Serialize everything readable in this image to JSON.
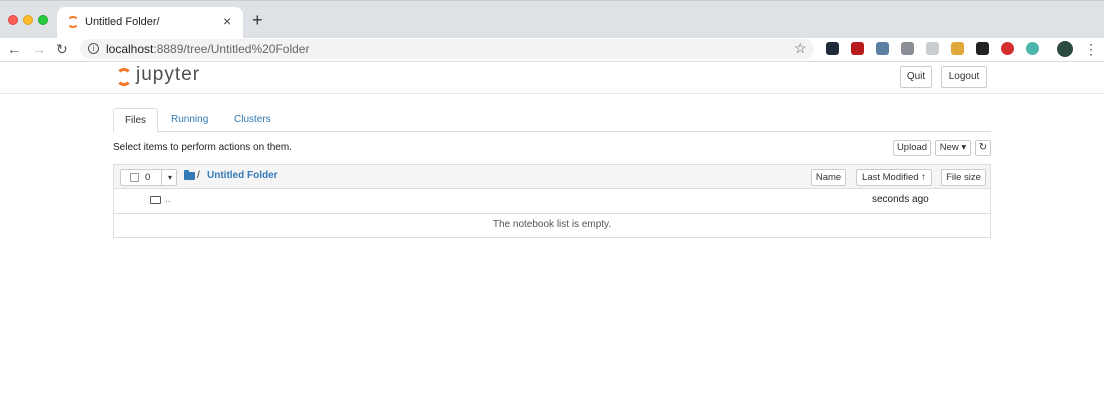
{
  "browser": {
    "tab_title": "Untitled Folder/",
    "url_host": "localhost",
    "url_rest": ":8889/tree/Untitled%20Folder",
    "new_tab_label": "+",
    "close_tab_label": "×",
    "extensions": [
      "react-devtools-icon",
      "red-extension-icon",
      "shield-blue-icon",
      "shield-gray-icon",
      "timer-icon",
      "pencil-icon",
      "notion-icon",
      "adblock-icon",
      "globe-icon",
      "avatar-icon"
    ],
    "extension_colors": [
      "#1e2a3a",
      "#b71c1c",
      "#5c7fa3",
      "#8a8f96",
      "#c8cdd2",
      "#e0a83a",
      "#222222",
      "#d32f2f",
      "#4db6ac",
      "#2d4a3e"
    ]
  },
  "jupyter": {
    "logo_text": "jupyter",
    "quit_label": "Quit",
    "logout_label": "Logout",
    "tabs": [
      {
        "label": "Files"
      },
      {
        "label": "Running"
      },
      {
        "label": "Clusters"
      }
    ],
    "select_hint": "Select items to perform actions on them.",
    "upload_label": "Upload",
    "new_label": "New ▾",
    "refresh_glyph": "↻",
    "selected_count": "0",
    "breadcrumb_separator": "/",
    "breadcrumb_folder": "Untitled Folder",
    "columns": {
      "name": "Name",
      "last_modified": "Last Modified ↑",
      "file_size": "File size"
    },
    "parent_row": {
      "name": "..",
      "modified": "seconds ago"
    },
    "empty_message": "The notebook list is empty."
  }
}
